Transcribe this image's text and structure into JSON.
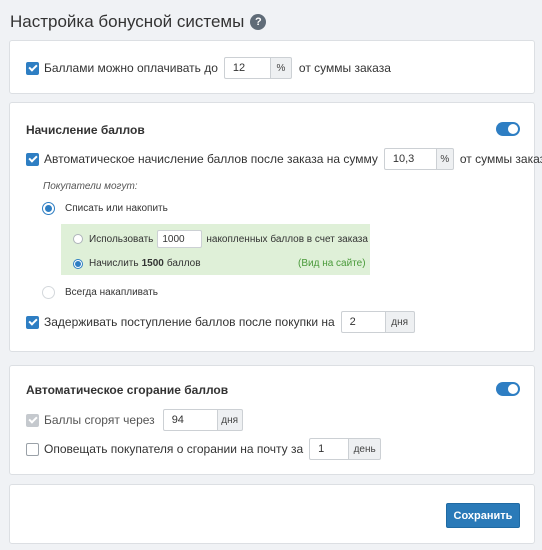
{
  "page": {
    "title": "Настройка бонусной системы",
    "help_icon_text": "?"
  },
  "payment": {
    "label": "Баллами можно оплачивать до",
    "value": "12",
    "unit": "%",
    "suffix": "от суммы заказа",
    "checked": true
  },
  "accrual": {
    "title": "Начисление баллов",
    "enabled": true,
    "auto": {
      "label": "Автоматическое начисление баллов после заказа на сумму",
      "value": "10,3",
      "unit": "%",
      "suffix": "от суммы заказа",
      "checked": true
    },
    "buyers_can": "Покупатели могут:",
    "options": [
      {
        "label": "Списать или накопить",
        "selected": true
      },
      {
        "label": "Всегда накапливать",
        "selected": false
      }
    ],
    "sub": {
      "use_label": "Использовать",
      "use_value": "1000",
      "use_suffix": "накопленных баллов в счет заказа",
      "accrue_prefix": "Начислить",
      "accrue_amount": "1500",
      "accrue_suffix": "баллов",
      "view_note": "(Вид на сайте)"
    },
    "delay": {
      "label": "Задерживать поступление баллов после покупки на",
      "value": "2",
      "unit": "дня",
      "checked": true
    }
  },
  "expiry": {
    "title": "Автоматическое сгорание баллов",
    "enabled": true,
    "burn": {
      "label": "Баллы сгорят через",
      "value": "94",
      "unit": "дня",
      "checked": true,
      "disabled": true
    },
    "notify": {
      "label": "Оповещать покупателя о сгорании на почту за",
      "value": "1",
      "unit": "день",
      "checked": false
    }
  },
  "actions": {
    "save_label": "Сохранить"
  },
  "colors": {
    "accent": "#2e7ec3",
    "green_bg": "#dff0d8",
    "green_text": "#4a9a3a",
    "page_bg": "#f0f2f5"
  }
}
